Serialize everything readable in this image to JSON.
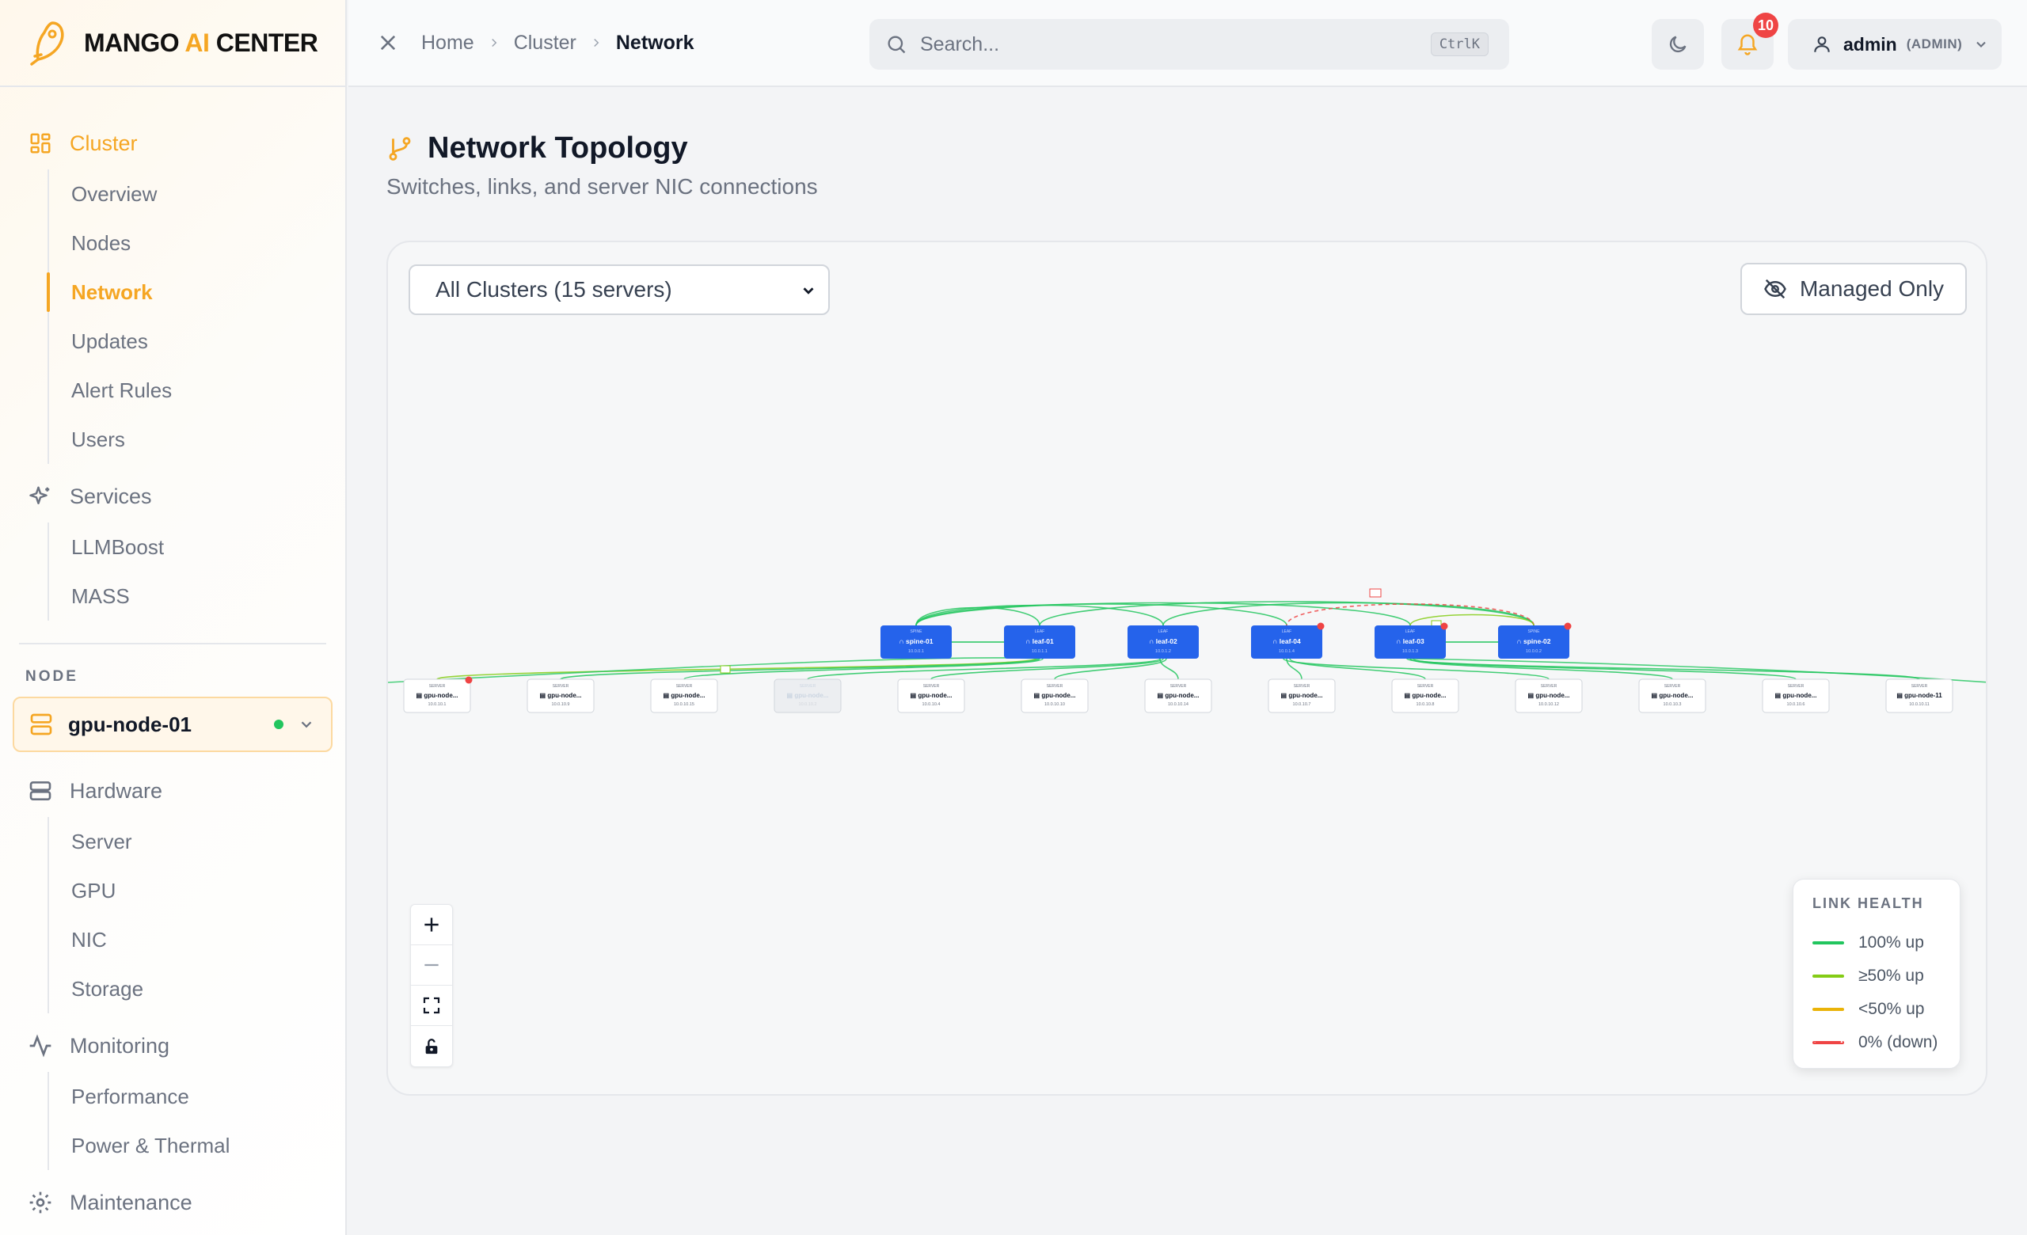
{
  "brand": {
    "name_prefix": "MANGO ",
    "name_ai": "AI",
    "name_suffix": " CENTER"
  },
  "sidebar": {
    "cluster": {
      "label": "Cluster",
      "items": [
        "Overview",
        "Nodes",
        "Network",
        "Updates",
        "Alert Rules",
        "Users"
      ]
    },
    "services": {
      "label": "Services",
      "items": [
        "LLMBoost",
        "MASS"
      ]
    },
    "node_label": "NODE",
    "node_select": "gpu-node-01",
    "hardware": {
      "label": "Hardware",
      "items": [
        "Server",
        "GPU",
        "NIC",
        "Storage"
      ]
    },
    "monitoring": {
      "label": "Monitoring",
      "items": [
        "Performance",
        "Power & Thermal"
      ]
    },
    "maintenance": {
      "label": "Maintenance"
    }
  },
  "topbar": {
    "breadcrumb": [
      "Home",
      "Cluster",
      "Network"
    ],
    "search_placeholder": "Search...",
    "search_shortcut": "CtrlK",
    "notification_count": "10",
    "user_name": "admin",
    "user_role": "(ADMIN)"
  },
  "page": {
    "title": "Network Topology",
    "subtitle": "Switches, links, and server NIC connections"
  },
  "controls": {
    "cluster_select": "All Clusters (15 servers)",
    "managed_only": "Managed Only"
  },
  "legend": {
    "title": "LINK HEALTH",
    "items": [
      {
        "label": "100% up",
        "color": "#22c55e"
      },
      {
        "label": "≥50% up",
        "color": "#84cc16"
      },
      {
        "label": "<50% up",
        "color": "#eab308"
      },
      {
        "label": "0% (down)",
        "color": "#ef4444"
      }
    ]
  },
  "switches": [
    {
      "name": "spine-01",
      "type": "SPINE",
      "ip": "10.0.0.1"
    },
    {
      "name": "leaf-01",
      "type": "LEAF",
      "ip": "10.0.1.1"
    },
    {
      "name": "leaf-02",
      "type": "LEAF",
      "ip": "10.0.1.2"
    },
    {
      "name": "leaf-04",
      "type": "LEAF",
      "ip": "10.0.1.4"
    },
    {
      "name": "leaf-03",
      "type": "LEAF",
      "ip": "10.0.1.3"
    },
    {
      "name": "spine-02",
      "type": "SPINE",
      "ip": "10.0.0.2"
    }
  ],
  "servers": [
    {
      "name": "gpu-node...",
      "type": "SERVER",
      "ip": "10.0.10.1"
    },
    {
      "name": "gpu-node...",
      "type": "SERVER",
      "ip": "10.0.10.9"
    },
    {
      "name": "gpu-node...",
      "type": "SERVER",
      "ip": "10.0.10.15"
    },
    {
      "name": "gpu-node...",
      "type": "SERVER",
      "ip": "10.0.10.2"
    },
    {
      "name": "gpu-node...",
      "type": "SERVER",
      "ip": "10.0.10.4"
    },
    {
      "name": "gpu-node...",
      "type": "SERVER",
      "ip": "10.0.10.10"
    },
    {
      "name": "gpu-node...",
      "type": "SERVER",
      "ip": "10.0.10.14"
    },
    {
      "name": "gpu-node...",
      "type": "SERVER",
      "ip": "10.0.10.7"
    },
    {
      "name": "gpu-node...",
      "type": "SERVER",
      "ip": "10.0.10.8"
    },
    {
      "name": "gpu-node...",
      "type": "SERVER",
      "ip": "10.0.10.12"
    },
    {
      "name": "gpu-node...",
      "type": "SERVER",
      "ip": "10.0.10.3"
    },
    {
      "name": "gpu-node...",
      "type": "SERVER",
      "ip": "10.0.10.6"
    },
    {
      "name": "gpu-node-11",
      "type": "SERVER",
      "ip": "10.0.10.11"
    }
  ]
}
